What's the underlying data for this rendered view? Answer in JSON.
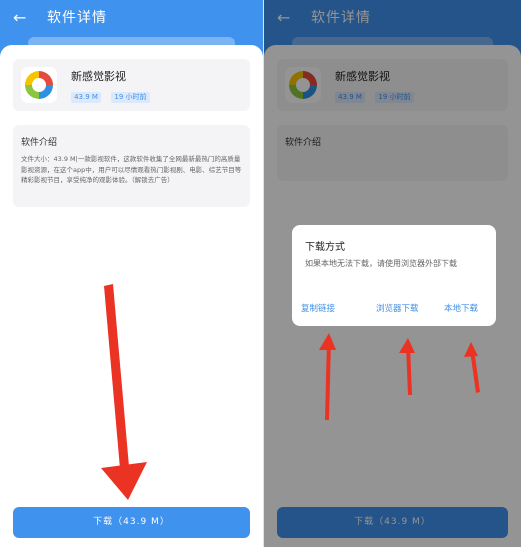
{
  "left_screen": {
    "back_icon": "arrow-left-icon",
    "title": "软件详情",
    "app": {
      "name": "新感觉影视",
      "size_badge": "43.9 M",
      "time_badge": "19 小时前",
      "icon": "app-logo-icon"
    },
    "intro": {
      "title": "软件介绍",
      "body": "文件大小：43.9 M|一款影视软件，这款软件收集了全网最新最热门的高质量影视资源，在这个app中，用户可以尽情观看热门影视剧、电影、综艺节目等精彩影视节目，享受纯净的观影体验。（解锁去广告）"
    },
    "download_button": "下载（43.9 M）"
  },
  "right_screen": {
    "back_icon": "arrow-left-icon",
    "title": "软件详情",
    "app": {
      "name": "新感觉影视",
      "size_badge": "43.9 M",
      "time_badge": "19 小时前"
    },
    "intro": {
      "title": "软件介绍"
    },
    "download_button": "下载（43.9 M）",
    "dialog": {
      "title": "下载方式",
      "message": "如果本地无法下载，请使用浏览器外部下载",
      "actions": {
        "copy_link": "复制链接",
        "browser_download": "浏览器下载",
        "local_download": "本地下载"
      }
    }
  },
  "colors": {
    "accent": "#3f92ed",
    "annotation_arrow": "#ea3323"
  }
}
